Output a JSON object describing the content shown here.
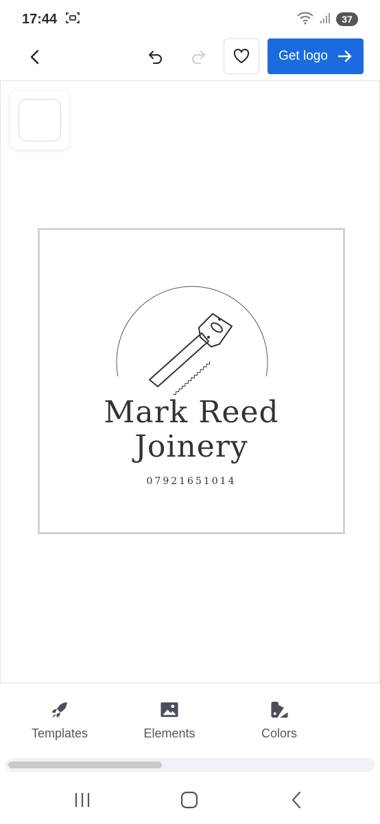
{
  "status_bar": {
    "time": "17:44",
    "battery": "37",
    "icons": [
      "screenshot-icon",
      "wifi-icon",
      "signal-icon",
      "battery-icon"
    ]
  },
  "toolbar": {
    "get_logo_label": "Get logo",
    "icons": [
      "back-arrow-icon",
      "undo-icon",
      "redo-icon",
      "heart-icon",
      "arrow-right-icon"
    ]
  },
  "logo": {
    "line1": "Mark Reed",
    "line2": "Joinery",
    "phone": "07921651014",
    "emblem": "saw-icon"
  },
  "bottom_tools": [
    {
      "label": "Templates",
      "icon": "rocket-icon"
    },
    {
      "label": "Elements",
      "icon": "image-icon"
    },
    {
      "label": "Colors",
      "icon": "palette-icon"
    }
  ],
  "nav": {
    "icons": [
      "recent-apps-icon",
      "home-icon",
      "back-icon"
    ]
  },
  "colors": {
    "accent": "#1a6be0",
    "text": "#333333"
  }
}
